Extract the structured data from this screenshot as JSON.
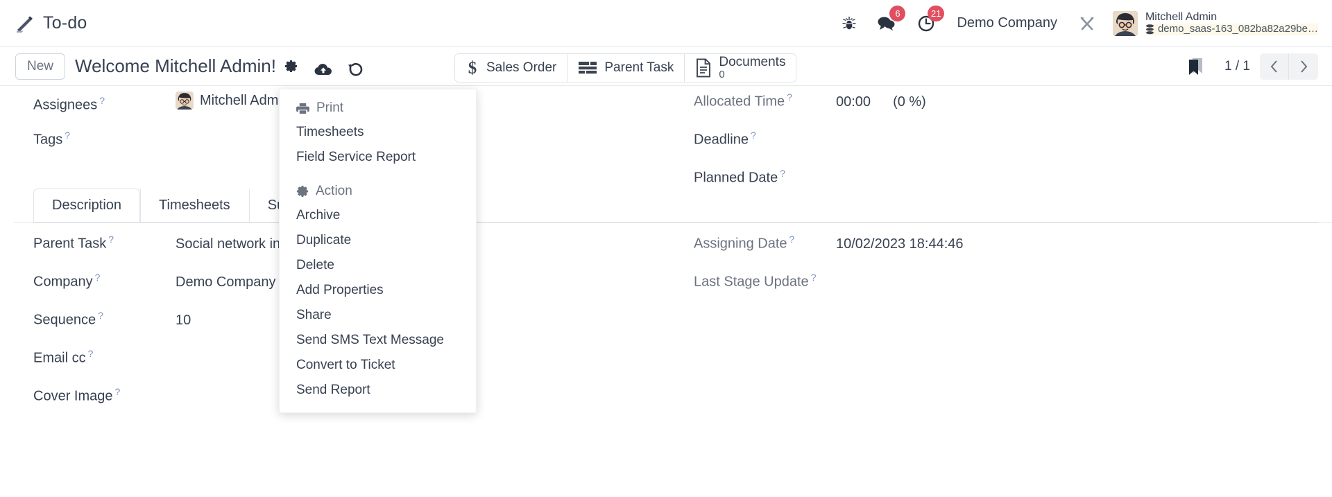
{
  "navbar": {
    "app_name": "To-do",
    "app_icon": "pencil-icon",
    "icons": [
      {
        "name": "bug-icon",
        "label": ""
      },
      {
        "name": "messages-icon",
        "badge": "6"
      },
      {
        "name": "activities-clock-icon",
        "badge": "21"
      }
    ],
    "company": "Demo Company",
    "settings_icon": "tools-icon",
    "user": {
      "name": "Mitchell Admin",
      "database": "demo_saas-163_082ba82a29be…",
      "db_icon": "database-icon"
    },
    "accent_badge_color": "#e04f5f"
  },
  "control_panel": {
    "new_button": "New",
    "title": "Welcome Mitchell Admin!",
    "icons": [
      {
        "name": "gear-icon"
      },
      {
        "name": "cloud-save-icon"
      },
      {
        "name": "discard-undo-icon"
      }
    ],
    "smart_buttons": [
      {
        "name": "sales-order",
        "icon": "dollar-icon",
        "label": "Sales Order",
        "value": ""
      },
      {
        "name": "parent-task",
        "icon": "list-rows-icon",
        "label": "Parent Task",
        "value": ""
      },
      {
        "name": "documents",
        "icon": "document-icon",
        "label": "Documents",
        "value": "0"
      }
    ],
    "bookmark_icon": "bookmark-icon",
    "pager": "1 / 1",
    "prev_label": "‹",
    "next_label": "›"
  },
  "form": {
    "left_fields": [
      {
        "label": "Assignees",
        "value": "Mitchell Admin",
        "type": "tag",
        "remove": "✖"
      },
      {
        "label": "Tags",
        "value": "",
        "type": "text"
      }
    ],
    "right_fields": [
      {
        "label": "Allocated Time",
        "value": "00:00",
        "extra": "(0 %)"
      },
      {
        "label": "Deadline",
        "value": "",
        "extra": ""
      },
      {
        "label": "Planned Date",
        "value": "",
        "extra": ""
      }
    ]
  },
  "notebook": {
    "tabs": [
      {
        "label": "Description",
        "active": true
      },
      {
        "label": "Timesheets",
        "active": false
      },
      {
        "label": "Su",
        "active": false
      }
    ]
  },
  "details": {
    "left_fields": [
      {
        "label": "Parent Task",
        "value": "Social network integr"
      },
      {
        "label": "Company",
        "value": "Demo Company"
      },
      {
        "label": "Sequence",
        "value": "10"
      },
      {
        "label": "Email cc",
        "value": ""
      },
      {
        "label": "Cover Image",
        "value": ""
      }
    ],
    "right_fields": [
      {
        "label": "Assigning Date",
        "value": "10/02/2023 18:44:46"
      },
      {
        "label": "Last Stage Update",
        "value": ""
      }
    ]
  },
  "dropdown": {
    "print_header": {
      "label": "Print",
      "icon": "printer-icon"
    },
    "print_items": [
      "Timesheets",
      "Field Service Report"
    ],
    "action_header": {
      "label": "Action",
      "icon": "gear-icon"
    },
    "action_items": [
      "Archive",
      "Duplicate",
      "Delete",
      "Add Properties",
      "Share",
      "Send SMS Text Message",
      "Convert to Ticket",
      "Send Report"
    ]
  }
}
